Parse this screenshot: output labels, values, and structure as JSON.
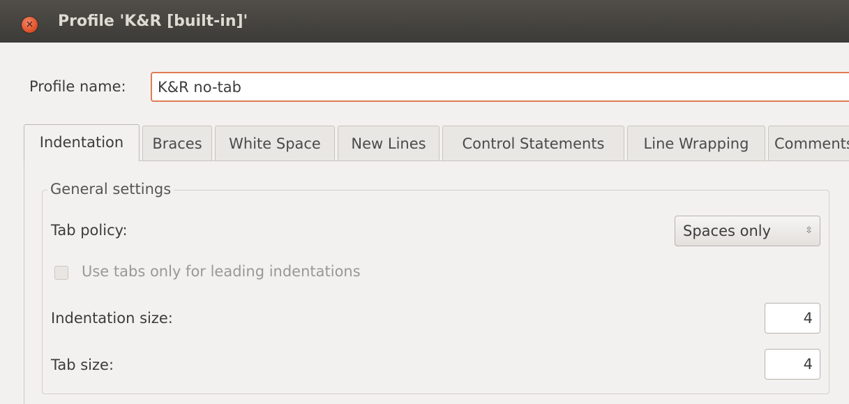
{
  "window": {
    "title": "Profile 'K&R [built-in]'",
    "close_symbol": "×"
  },
  "profile": {
    "label": "Profile name:",
    "value": "K&R no-tab"
  },
  "tabs": [
    {
      "label": "Indentation",
      "active": true
    },
    {
      "label": "Braces",
      "active": false
    },
    {
      "label": "White Space",
      "active": false
    },
    {
      "label": "New Lines",
      "active": false
    },
    {
      "label": "Control Statements",
      "active": false
    },
    {
      "label": "Line Wrapping",
      "active": false
    },
    {
      "label": "Comments",
      "active": false
    }
  ],
  "general": {
    "title": "General settings",
    "tab_policy_label": "Tab policy:",
    "tab_policy_value": "Spaces only",
    "tab_policy_arrows": "⌃⌄",
    "leading_tabs_label": "Use tabs only for leading indentations",
    "leading_tabs_checked": false,
    "leading_tabs_enabled": false,
    "indentation_size_label": "Indentation size:",
    "indentation_size_value": "4",
    "tab_size_label": "Tab size:",
    "tab_size_value": "4"
  },
  "colors": {
    "titlebar": "#3c3b37",
    "close_button": "#e1542c",
    "focus_border": "#e07b53",
    "window_bg": "#f2f1f0"
  }
}
